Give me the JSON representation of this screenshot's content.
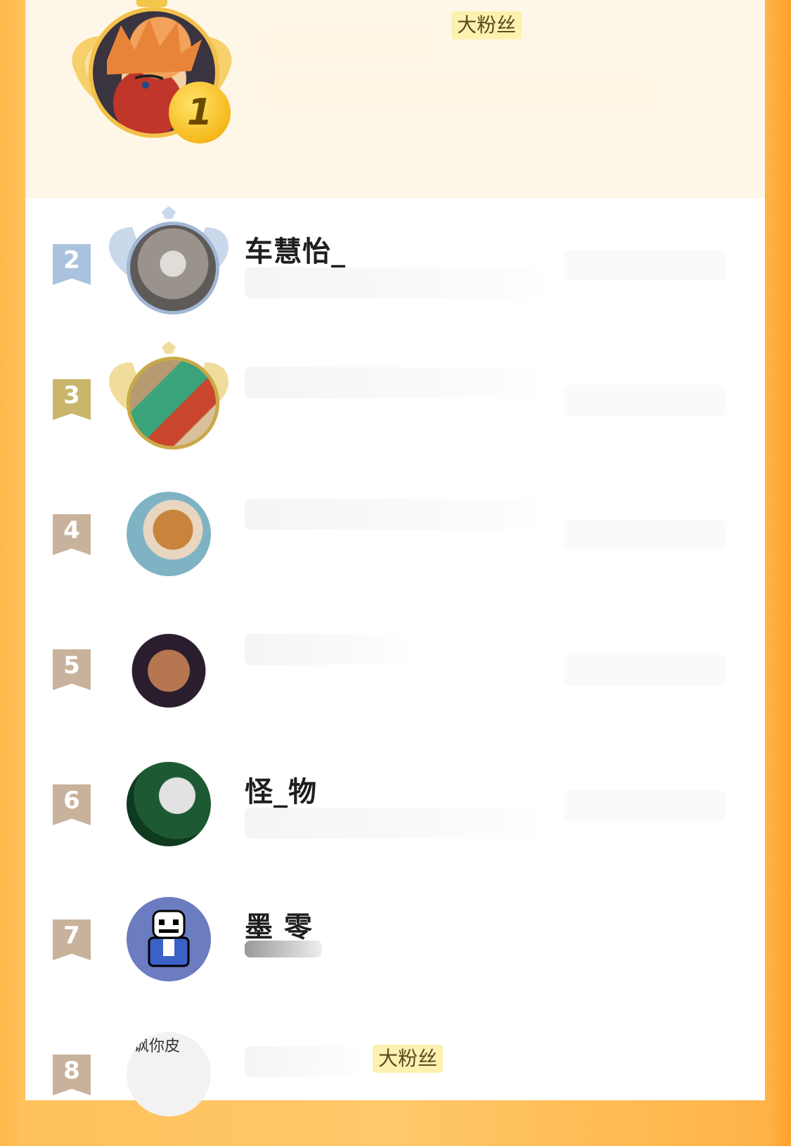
{
  "top": {
    "rank": "1",
    "badge": "大粉丝"
  },
  "rows": [
    {
      "rank": "2",
      "name": "车慧怡_",
      "flag_color": "#a9c2de",
      "ring": "#9fb6d4"
    },
    {
      "rank": "3",
      "name": "",
      "flag_color": "#c9b56b",
      "ring": "#c9a948"
    },
    {
      "rank": "4",
      "name": "",
      "flag_color": "#c9b29b"
    },
    {
      "rank": "5",
      "name": "",
      "flag_color": "#c9b29b"
    },
    {
      "rank": "6",
      "name": "怪_物",
      "flag_color": "#c9b29b"
    },
    {
      "rank": "7",
      "name": "墨 零",
      "flag_color": "#c9b29b"
    },
    {
      "rank": "8",
      "name": "",
      "badge": "大粉丝",
      "avatar_text": "讽你皮",
      "flag_color": "#c9b29b"
    }
  ],
  "colors": {
    "background_orange": "#ffc869",
    "top_card": "#fef7e8",
    "badge_yellow": "#fdf1b0"
  },
  "icons": [
    "gold-wings-icon",
    "silver-wings-icon",
    "bronze-wings-icon",
    "rank-flag-icon",
    "rank-number-badge-icon"
  ]
}
